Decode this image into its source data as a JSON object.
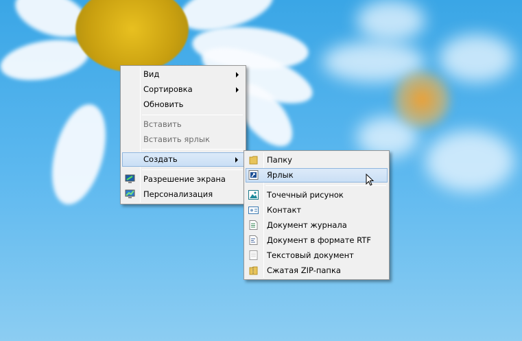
{
  "context_menu": {
    "items": [
      {
        "label": "Вид",
        "submenu": true
      },
      {
        "label": "Сортировка",
        "submenu": true
      },
      {
        "label": "Обновить"
      },
      {
        "label": "Вставить",
        "disabled": true
      },
      {
        "label": "Вставить ярлык",
        "disabled": true
      },
      {
        "label": "Создать",
        "submenu": true,
        "highlighted": true
      },
      {
        "label": "Разрешение экрана",
        "icon": "display-settings-icon"
      },
      {
        "label": "Персонализация",
        "icon": "personalization-icon"
      }
    ]
  },
  "create_submenu": {
    "items": [
      {
        "label": "Папку",
        "icon": "folder-icon"
      },
      {
        "label": "Ярлык",
        "icon": "shortcut-icon",
        "highlighted": true
      },
      {
        "label": "Точечный рисунок",
        "icon": "bitmap-image-icon"
      },
      {
        "label": "Контакт",
        "icon": "contact-icon"
      },
      {
        "label": "Документ журнала",
        "icon": "journal-document-icon"
      },
      {
        "label": "Документ в формате RTF",
        "icon": "rtf-document-icon"
      },
      {
        "label": "Текстовый документ",
        "icon": "text-document-icon"
      },
      {
        "label": "Сжатая ZIP-папка",
        "icon": "zip-folder-icon"
      }
    ]
  },
  "colors": {
    "highlight": "#cadff5",
    "highlight_border": "#8fb5de",
    "menu_bg": "#f0f0f0"
  }
}
